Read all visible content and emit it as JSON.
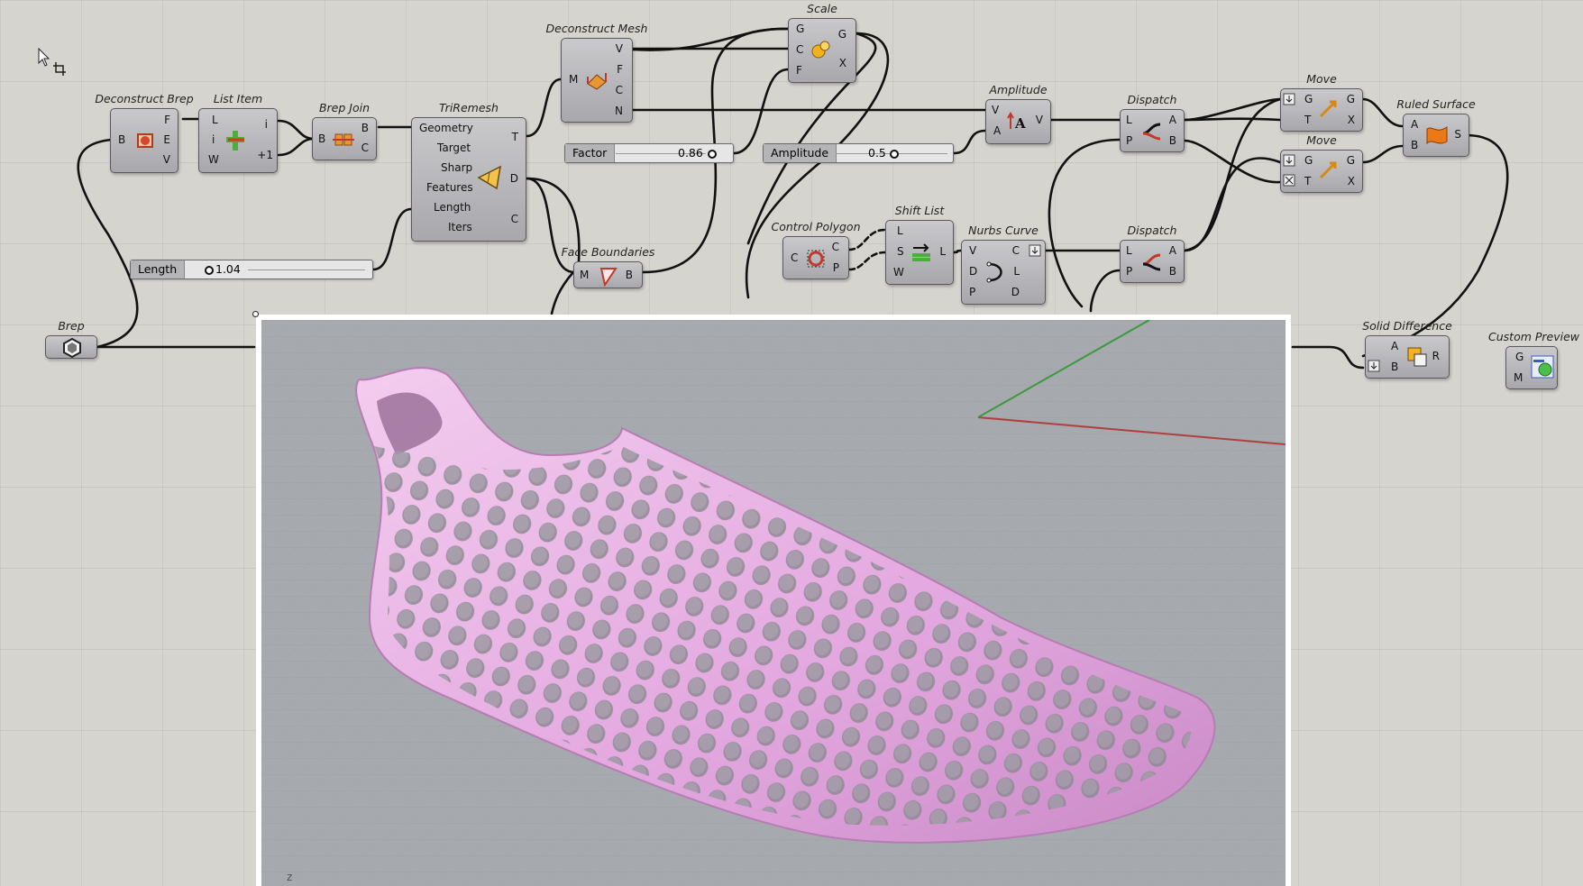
{
  "components": {
    "deconstruct_brep": {
      "title": "Deconstruct Brep",
      "in": [
        "B"
      ],
      "out": [
        "F",
        "E",
        "V"
      ]
    },
    "list_item": {
      "title": "List Item",
      "in": [
        "L",
        "i",
        "W"
      ],
      "out": [
        "i",
        "+1"
      ]
    },
    "brep_join": {
      "title": "Brep Join",
      "in": [
        "B"
      ],
      "out": [
        "B",
        "C"
      ]
    },
    "triremesh": {
      "title": "TriRemesh",
      "in": [
        "Geometry",
        "Target",
        "Sharp",
        "Features",
        "Length",
        "Iters"
      ],
      "out": [
        "T",
        "D",
        "C"
      ]
    },
    "deconstruct_mesh": {
      "title": "Deconstruct Mesh",
      "in": [
        "M"
      ],
      "out": [
        "V",
        "F",
        "C",
        "N"
      ]
    },
    "scale": {
      "title": "Scale",
      "in": [
        "G",
        "C",
        "F"
      ],
      "out": [
        "G",
        "X"
      ]
    },
    "face_boundaries": {
      "title": "Face Boundaries",
      "in": [
        "M"
      ],
      "out": [
        "B"
      ]
    },
    "amplitude": {
      "title": "Amplitude",
      "in": [
        "V",
        "A"
      ],
      "out": [
        "V"
      ]
    },
    "dispatch_top": {
      "title": "Dispatch",
      "in": [
        "L",
        "P"
      ],
      "out": [
        "A",
        "B"
      ]
    },
    "move_top": {
      "title": "Move",
      "in": [
        "G",
        "T"
      ],
      "out": [
        "G",
        "X"
      ]
    },
    "move_bottom": {
      "title": "Move",
      "in": [
        "G",
        "T"
      ],
      "out": [
        "G",
        "X"
      ]
    },
    "ruled_surface": {
      "title": "Ruled Surface",
      "in": [
        "A",
        "B"
      ],
      "out": [
        "S"
      ]
    },
    "control_polygon": {
      "title": "Control Polygon",
      "in": [
        "C"
      ],
      "out": [
        "C",
        "P"
      ]
    },
    "shift_list": {
      "title": "Shift List",
      "in": [
        "L",
        "S",
        "W"
      ],
      "out": [
        "L"
      ]
    },
    "nurbs_curve": {
      "title": "Nurbs Curve",
      "in": [
        "V",
        "D",
        "P"
      ],
      "out": [
        "C",
        "L",
        "D"
      ]
    },
    "dispatch_bottom": {
      "title": "Dispatch",
      "in": [
        "L",
        "P"
      ],
      "out": [
        "A",
        "B"
      ]
    },
    "brep": {
      "title": "Brep"
    },
    "solid_difference": {
      "title": "Solid Difference",
      "in": [
        "A",
        "B"
      ],
      "out": [
        "R"
      ]
    },
    "custom_preview": {
      "title": "Custom Preview",
      "in": [
        "G",
        "M"
      ]
    }
  },
  "sliders": {
    "length": {
      "label": "Length",
      "value": "1.04"
    },
    "factor": {
      "label": "Factor",
      "value": "0.86"
    },
    "amplitude": {
      "label": "Amplitude",
      "value": "0.5"
    }
  },
  "viewport": {
    "axis_label": "z"
  },
  "colors": {
    "shoe": "#e8b3e3",
    "viewport_bg": "#a6a9ae",
    "canvas": "#d6d4cf",
    "x_axis": "#b04040",
    "y_axis": "#3a9a3a"
  },
  "icons": [
    "cursor-icon",
    "deconstruct-brep-icon",
    "list-item-icon",
    "brep-join-icon",
    "triremesh-icon",
    "deconstruct-mesh-icon",
    "scale-icon",
    "face-boundaries-icon",
    "amplitude-icon",
    "dispatch-icon",
    "move-icon",
    "ruled-surface-icon",
    "control-polygon-icon",
    "shift-list-icon",
    "nurbs-curve-icon",
    "brep-param-icon",
    "solid-difference-icon",
    "custom-preview-icon"
  ]
}
